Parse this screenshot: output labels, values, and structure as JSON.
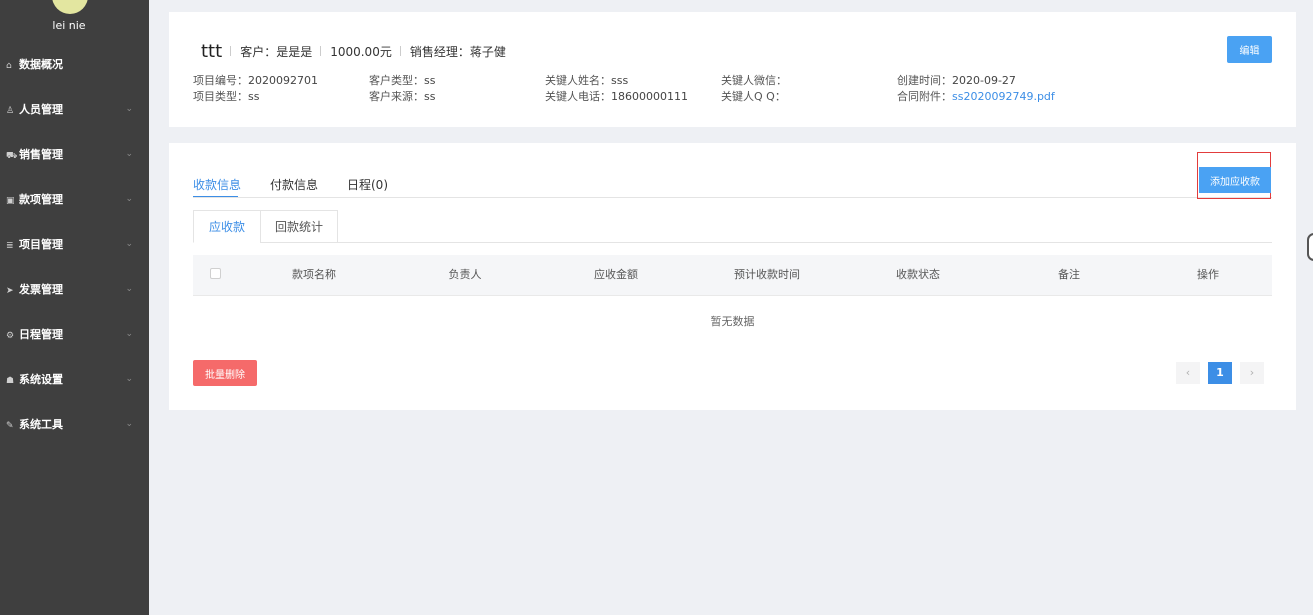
{
  "user": {
    "name": "lei nie"
  },
  "sidebar": {
    "items": [
      {
        "icon": "home-icon",
        "glyph": "⌂",
        "label": "数据概况",
        "expandable": false
      },
      {
        "icon": "user-icon",
        "glyph": "♙",
        "label": "人员管理",
        "expandable": true
      },
      {
        "icon": "cart-icon",
        "glyph": "⛟",
        "label": "销售管理",
        "expandable": true
      },
      {
        "icon": "money-icon",
        "glyph": "▣",
        "label": "款项管理",
        "expandable": true
      },
      {
        "icon": "database-icon",
        "glyph": "≣",
        "label": "项目管理",
        "expandable": true
      },
      {
        "icon": "send-icon",
        "glyph": "➤",
        "label": "发票管理",
        "expandable": true
      },
      {
        "icon": "gear-icon",
        "glyph": "⚙",
        "label": "日程管理",
        "expandable": true
      },
      {
        "icon": "users-icon",
        "glyph": "☗",
        "label": "系统设置",
        "expandable": true
      },
      {
        "icon": "wrench-icon",
        "glyph": "✎",
        "label": "系统工具",
        "expandable": true
      }
    ],
    "chevron": "⌄"
  },
  "project": {
    "name": "ttt",
    "customer": "客户：是是是",
    "amount": "1000.00元",
    "manager": "销售经理：蒋子健",
    "edit_label": "编辑",
    "fields": {
      "project_no": {
        "label": "项目编号：",
        "value": "2020092701"
      },
      "customer_type": {
        "label": "客户类型：",
        "value": "ss"
      },
      "contact_name": {
        "label": "关键人姓名：",
        "value": "sss"
      },
      "contact_wechat": {
        "label": "关键人微信：",
        "value": ""
      },
      "created": {
        "label": "创建时间：",
        "value": "2020-09-27"
      },
      "project_type": {
        "label": "项目类型：",
        "value": "ss"
      },
      "customer_src": {
        "label": "客户来源：",
        "value": "ss"
      },
      "contact_phone": {
        "label": "关键人电话：",
        "value": "18600000111"
      },
      "contact_qq": {
        "label": "关键人Q Q：",
        "value": ""
      },
      "attachment": {
        "label": "合同附件：",
        "value": "ss2020092749.pdf"
      }
    }
  },
  "tabs": [
    "收款信息",
    "付款信息",
    "日程(0)"
  ],
  "add_button": "添加应收款",
  "subtabs": [
    "应收款",
    "回款统计"
  ],
  "table": {
    "columns": [
      "款项名称",
      "负责人",
      "应收金额",
      "预计收款时间",
      "收款状态",
      "备注",
      "操作"
    ],
    "empty_text": "暂无数据"
  },
  "batch_delete": "批量删除",
  "pagination": {
    "prev": "‹",
    "current": "1",
    "next": "›"
  },
  "colors": {
    "primary": "#4aa2f3",
    "danger": "#f56a6a",
    "sidebar": "#3f3f3f",
    "highlight": "#e23c3c"
  }
}
